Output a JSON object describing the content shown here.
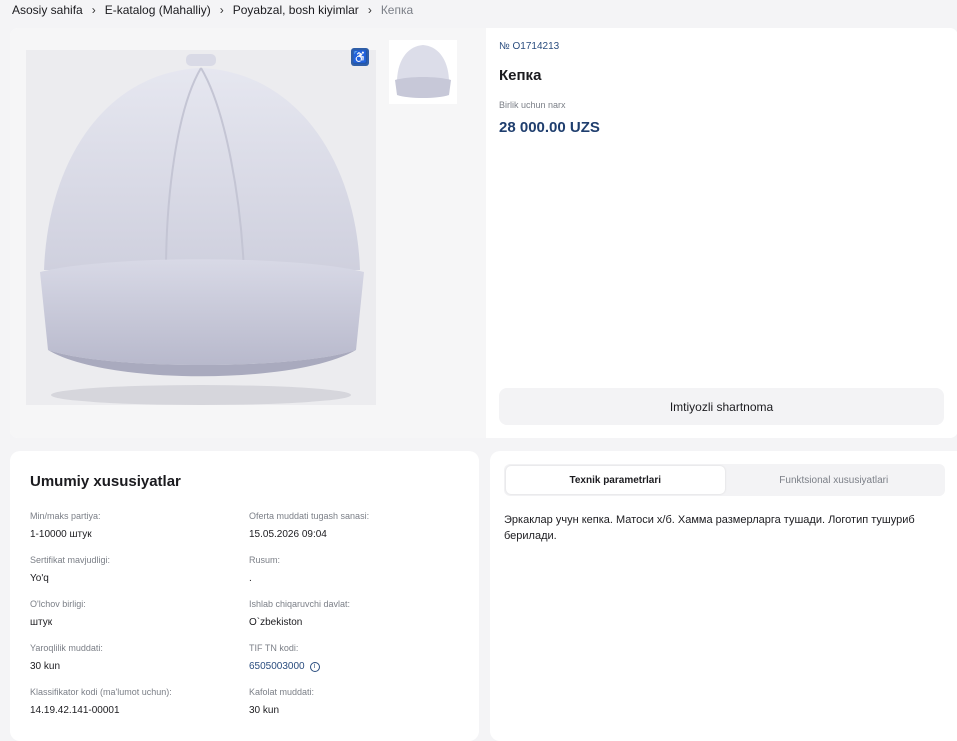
{
  "breadcrumb": {
    "items": [
      "Asosiy sahifa",
      "E-katalog (Mahalliy)",
      "Poyabzal, bosh kiyimlar"
    ],
    "current": "Кепка"
  },
  "product": {
    "code": "№ O1714213",
    "title": "Кепка",
    "price_label": "Birlik uchun narx",
    "price": "28 000.00 UZS",
    "contract_button": "Imtiyozli shartnoma",
    "image_icon": "accessibility-icon"
  },
  "specs": {
    "title": "Umumiy xususiyatlar",
    "items": [
      {
        "label": "Min/maks partiya:",
        "value": "1-10000 штук"
      },
      {
        "label": "Oferta muddati tugash sanasi:",
        "value": "15.05.2026 09:04"
      },
      {
        "label": "Sertifikat mavjudligi:",
        "value": "Yo'q"
      },
      {
        "label": "Rusum:",
        "value": "."
      },
      {
        "label": "O'lchov birligi:",
        "value": "штук"
      },
      {
        "label": "Ishlab chiqaruvchi davlat:",
        "value": "O`zbekiston"
      },
      {
        "label": "Yaroqlilik muddati:",
        "value": "30 kun"
      },
      {
        "label": "TIF TN kodi:",
        "value": "6505003000"
      },
      {
        "label": "Klassifikator kodi (ma'lumot uchun):",
        "value": "14.19.42.141-00001"
      },
      {
        "label": "Kafolat muddati:",
        "value": "30 kun"
      }
    ]
  },
  "tabs": {
    "items": [
      "Texnik parametrlari",
      "Funktsional xususiyatlari"
    ],
    "active": 0,
    "content": "Эркаклар учун кепка. Матоси х/б. Хамма размерларга тушади. Логотип тушуриб берилади."
  },
  "colors": {
    "accent": "#1f3e6e",
    "link": "#2a4d7f",
    "background": "#f4f4f6"
  }
}
